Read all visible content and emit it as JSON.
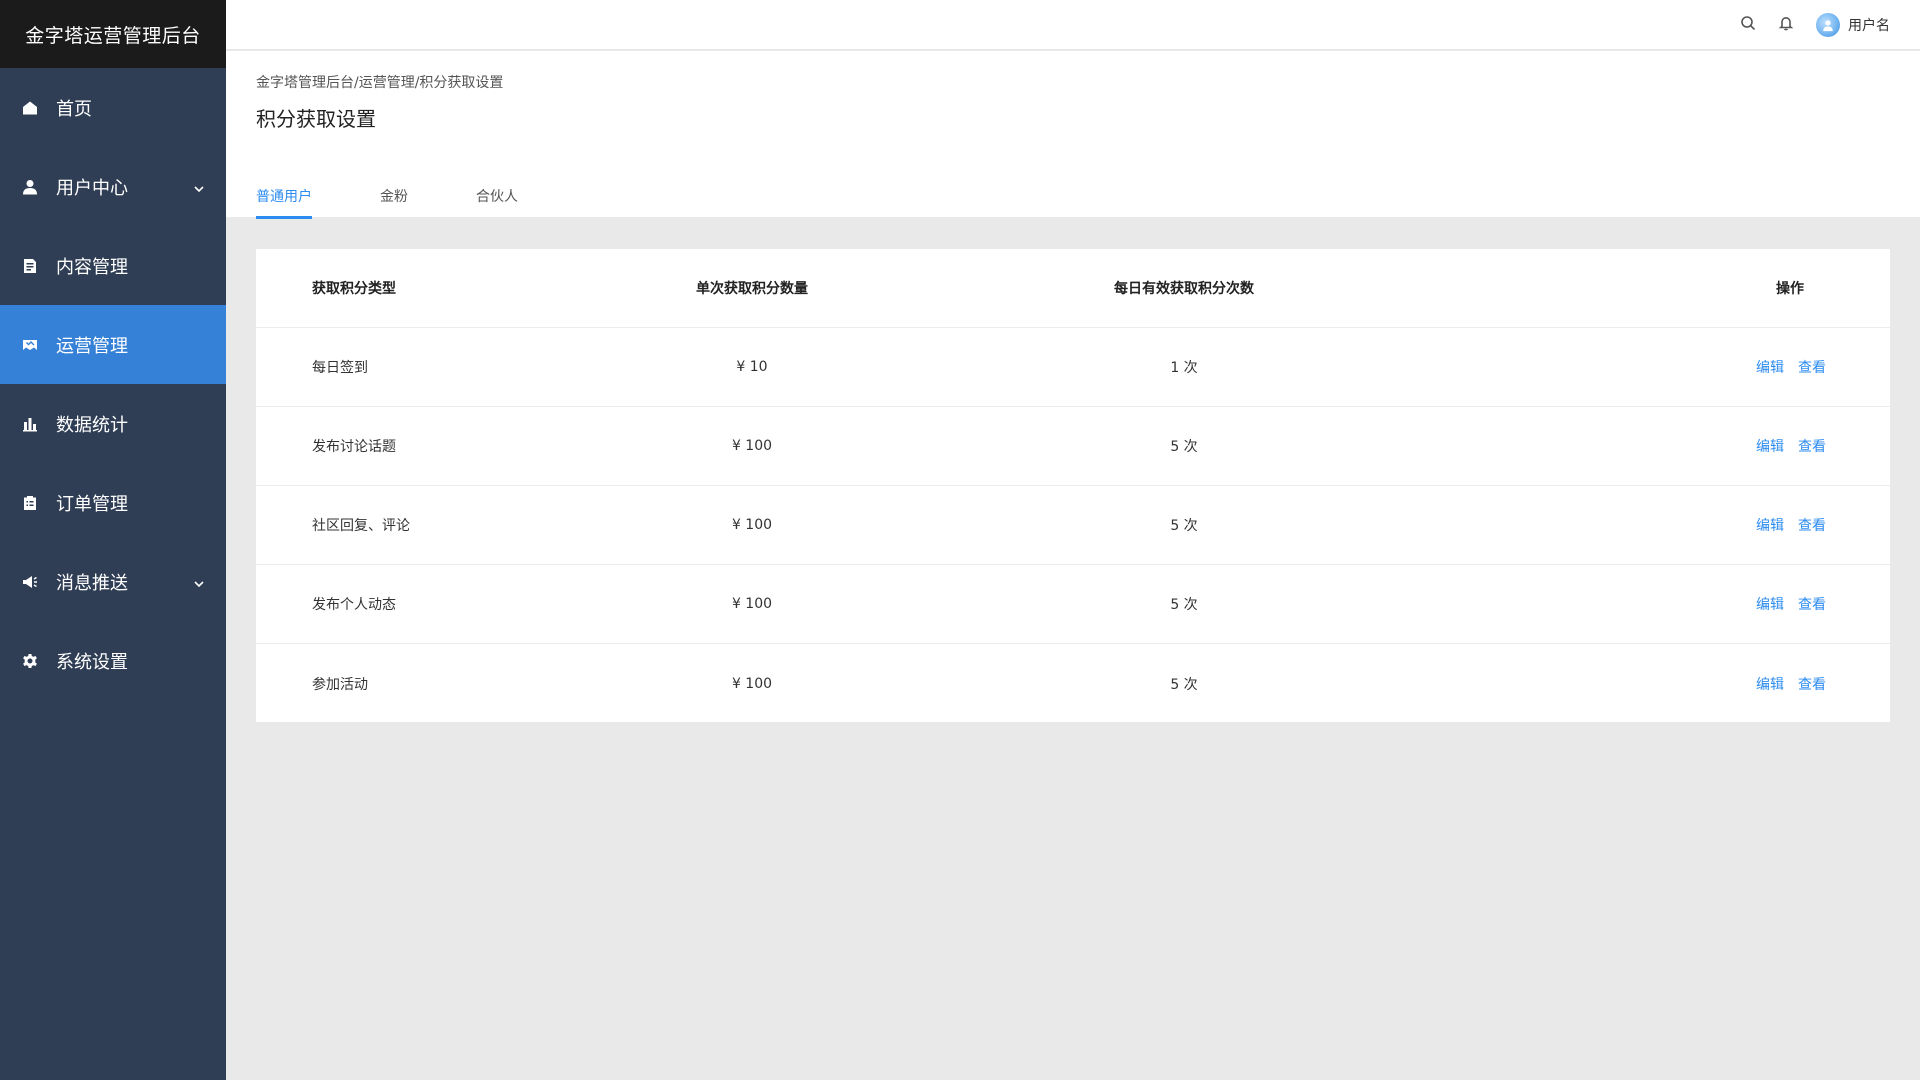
{
  "app": {
    "title": "金字塔运营管理后台"
  },
  "sidebar": {
    "items": [
      {
        "label": "首页",
        "icon": "home-icon"
      },
      {
        "label": "用户中心",
        "icon": "user-icon",
        "has_children": true
      },
      {
        "label": "内容管理",
        "icon": "document-icon"
      },
      {
        "label": "运营管理",
        "icon": "operations-icon",
        "active": true
      },
      {
        "label": "数据统计",
        "icon": "bar-chart-icon"
      },
      {
        "label": "订单管理",
        "icon": "clipboard-icon"
      },
      {
        "label": "消息推送",
        "icon": "megaphone-icon",
        "has_children": true
      },
      {
        "label": "系统设置",
        "icon": "gear-icon"
      }
    ]
  },
  "topbar": {
    "search_icon": "search-icon",
    "bell_icon": "bell-icon",
    "username": "用户名"
  },
  "breadcrumb": "金字塔管理后台/运营管理/积分获取设置",
  "page_title": "积分获取设置",
  "tabs": [
    {
      "label": "普通用户",
      "active": true
    },
    {
      "label": "金粉"
    },
    {
      "label": "合伙人"
    }
  ],
  "table": {
    "headers": [
      "获取积分类型",
      "单次获取积分数量",
      "每日有效获取积分次数",
      "操作"
    ],
    "rows": [
      {
        "type": "每日签到",
        "amount": "¥ 10",
        "times": "1 次"
      },
      {
        "type": "发布讨论话题",
        "amount": "¥ 100",
        "times": "5 次"
      },
      {
        "type": "社区回复、评论",
        "amount": "¥ 100",
        "times": "5 次"
      },
      {
        "type": "发布个人动态",
        "amount": "¥ 100",
        "times": "5 次"
      },
      {
        "type": "参加活动",
        "amount": "¥ 100",
        "times": "5 次"
      }
    ],
    "action_edit": "编辑",
    "action_view": "查看"
  },
  "colors": {
    "sidebar_bg": "#2f3e55",
    "brand_bg": "#1b1b1b",
    "active_bg": "#3581d7",
    "accent": "#2d8cf0"
  }
}
